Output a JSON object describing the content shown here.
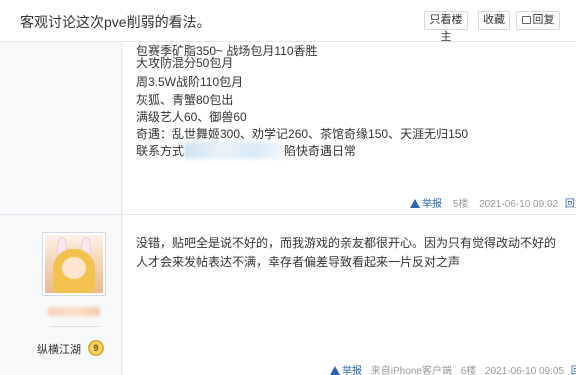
{
  "header": {
    "title": "客观讨论这次pve削弱的看法。",
    "buttons": {
      "only_author": "只看楼主",
      "favorite": "收藏",
      "reply": "回复"
    }
  },
  "post1": {
    "lines": [
      "包赛季矿脂350~ 战场包月110香胜",
      "大攻防混分50包月",
      "周3.5W战阶110包月",
      "灰狐、青蟹80包出",
      "满级艺人60、御兽60",
      "奇遇：乱世舞姬300、劝学记260、茶馆奇缘150、天涯无归150",
      "联系方式："
    ],
    "contact_tail": "陷快奇遇日常",
    "footer": {
      "report": "举报",
      "floor": "5楼",
      "time": "2021-06-10 09:02",
      "reply": "回复"
    }
  },
  "post2": {
    "user": {
      "level_name": "纵横江湖",
      "level_num": "9"
    },
    "text": "没错，贴吧全是说不好的，而我游戏的亲友都很开心。因为只有觉得改动不好的人才会来发帖表达不满，幸存者偏差导致看起来一片反对之声",
    "footer": {
      "report": "举报",
      "client": "来自iPhone客户端",
      "floor": "6楼",
      "time": "2021-06-10 09:05",
      "reply": "回复"
    }
  },
  "colors": {
    "link": "#2d64b3",
    "sidebar_bg": "#f7f8fa",
    "border": "#e4e6eb"
  }
}
